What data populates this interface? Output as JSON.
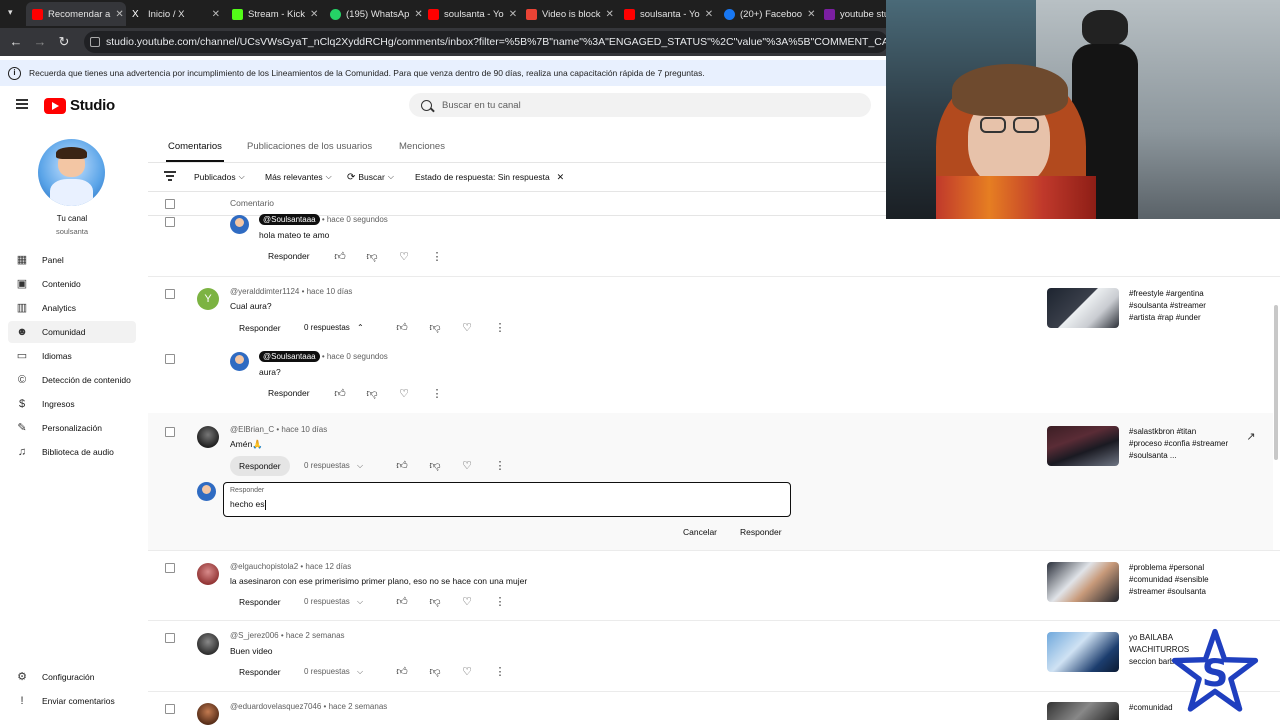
{
  "browser": {
    "tabs": [
      {
        "label": "Recomendar a",
        "color": "#ff0000",
        "active": true
      },
      {
        "label": "Inicio / X",
        "color": "#ffffff"
      },
      {
        "label": "Stream - Kick",
        "color": "#53fc18"
      },
      {
        "label": "(195) WhatsAp",
        "color": "#25d366"
      },
      {
        "label": "soulsanta - Yo",
        "color": "#ff0000"
      },
      {
        "label": "Video is block",
        "color": "#ea4335"
      },
      {
        "label": "soulsanta - Yo",
        "color": "#ff0000"
      },
      {
        "label": "(20+) Faceboo",
        "color": "#1877f2"
      },
      {
        "label": "youtube stud",
        "color": "#7b1fa2"
      }
    ],
    "url": "studio.youtube.com/channel/UCsVWsGyaT_nClq2XyddRCHg/comments/inbox?filter=%5B%7B\"name\"%3A\"ENGAGED_STATUS\"%2C\"value\"%3A%5B\"COMMENT_CATEGORY_NOT_ENGAGED\"%"
  },
  "banner": {
    "text": "Recuerda que tienes una advertencia por incumplimiento de los Lineamientos de la Comunidad. Para que venza dentro de 90 días, realiza una capacitación rápida de 7 preguntas."
  },
  "header": {
    "logo_text": "Studio",
    "search_placeholder": "Buscar en tu canal"
  },
  "sidebar": {
    "channel_label": "Tu canal",
    "channel_name": "soulsanta",
    "items": [
      {
        "label": "Panel",
        "icon": "dashboard-icon"
      },
      {
        "label": "Contenido",
        "icon": "content-icon"
      },
      {
        "label": "Analytics",
        "icon": "analytics-icon"
      },
      {
        "label": "Comunidad",
        "icon": "community-icon",
        "active": true
      },
      {
        "label": "Idiomas",
        "icon": "subtitles-icon"
      },
      {
        "label": "Detección de contenido",
        "icon": "copyright-icon"
      },
      {
        "label": "Ingresos",
        "icon": "dollar-icon"
      },
      {
        "label": "Personalización",
        "icon": "magic-wand-icon"
      },
      {
        "label": "Biblioteca de audio",
        "icon": "audio-library-icon"
      }
    ],
    "bottom_items": [
      {
        "label": "Configuración",
        "icon": "gear-icon"
      },
      {
        "label": "Enviar comentarios",
        "icon": "feedback-icon"
      }
    ]
  },
  "tabs": [
    "Comentarios",
    "Publicaciones de los usuarios",
    "Menciones"
  ],
  "filters": {
    "published": "Publicados",
    "relevant": "Más relevantes",
    "search": "Buscar",
    "status": "Estado de respuesta: Sin respuesta"
  },
  "table": {
    "column_header": "Comentario"
  },
  "comments": {
    "c0": {
      "author": "@Soulsantaaa",
      "time": "hace 0 segundos",
      "text": "hola mateo te amo",
      "reply": "Responder"
    },
    "c1": {
      "author": "@yeralddimter1124",
      "time": "hace 10 días",
      "text": "Cual aura?",
      "reply": "Responder",
      "replies": "0 respuestas",
      "video": "#freestyle #argentina #soulsanta #streamer #artista #rap #under"
    },
    "c1r": {
      "author": "@Soulsantaaa",
      "time": "hace 0 segundos",
      "text": "aura?",
      "reply": "Responder"
    },
    "c2": {
      "author": "@ElBrian_C",
      "time": "hace 10 días",
      "text": "Amén🙏",
      "reply": "Responder",
      "replies": "0 respuestas",
      "video": "#salastkbron #titan #proceso #confia #streamer #soulsanta ..."
    },
    "c3": {
      "author": "@elgauchopistola2",
      "time": "hace 12 días",
      "text": "la asesinaron con ese primerisimo primer plano, eso no se hace con una mujer",
      "reply": "Responder",
      "replies": "0 respuestas",
      "video": "#problema #personal #comunidad #sensible #streamer #soulsanta"
    },
    "c4": {
      "author": "@S_jerez006",
      "time": "hace 2 semanas",
      "text": "Buen video",
      "reply": "Responder",
      "replies": "0 respuestas",
      "video": "yo BAILABA WACHITURROS seccion barba"
    },
    "c5": {
      "author": "@eduardovelasquez7046",
      "time": "hace 2 semanas",
      "video": "#comunidad"
    }
  },
  "reply_box": {
    "label": "Responder",
    "value": "hecho es",
    "cancel": "Cancelar",
    "submit": "Responder"
  },
  "colors": {
    "accent": "#ff0000",
    "active_bg": "#f2f2f2",
    "banner_bg": "#e8f0fe"
  }
}
